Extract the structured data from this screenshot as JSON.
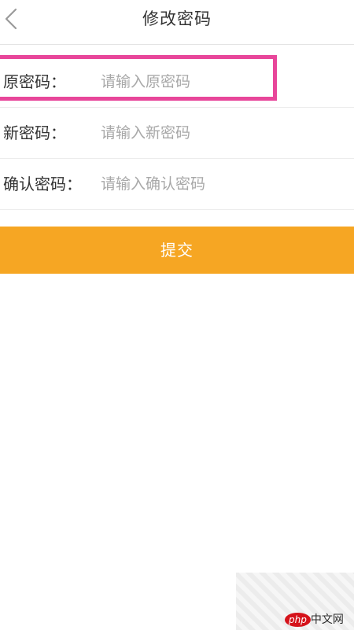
{
  "nav": {
    "title": "修改密码",
    "back_icon": "chevron-left-icon"
  },
  "form": {
    "rows": [
      {
        "label": "原密码：",
        "placeholder": "请输入原密码",
        "value": ""
      },
      {
        "label": "新密码：",
        "placeholder": "请输入新密码",
        "value": ""
      },
      {
        "label": "确认密码：",
        "placeholder": "请输入确认密码",
        "value": ""
      }
    ]
  },
  "submit": {
    "label": "提交"
  },
  "watermark": {
    "brand": "php",
    "site": "中文网"
  },
  "colors": {
    "accent": "#f6a623",
    "highlight": "#e8469a",
    "placeholder": "#a8a8a8",
    "text": "#333333"
  }
}
